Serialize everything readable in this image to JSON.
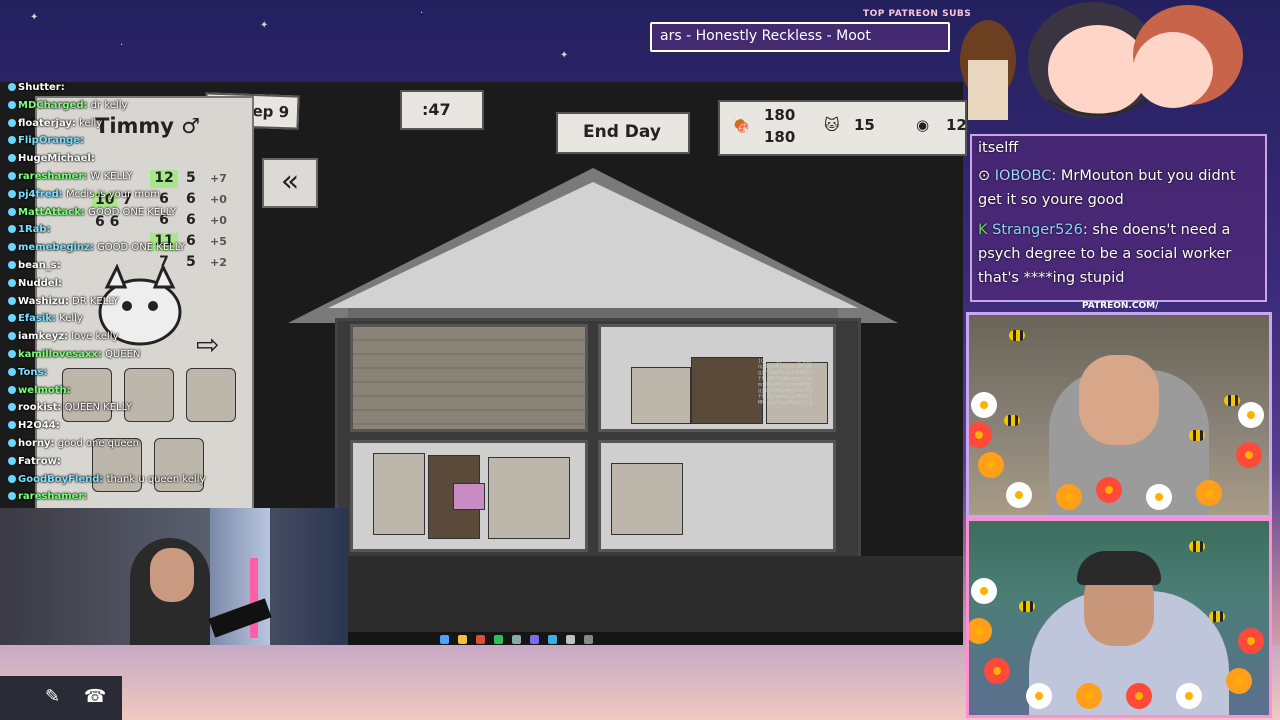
{
  "overlay": {
    "patreon_label": "TOP PATREON SUBS",
    "ticker_text": "ars - Honestly Reckless - Moot",
    "patreon_url": "PATREON.COM/"
  },
  "game": {
    "date": "Su Sep 9",
    "population": ":47",
    "end_day_label": "End Day",
    "food_current": "180",
    "food_max": "180",
    "cats_count": "15",
    "coins_count": "12",
    "cat_name": "Timmy ♂",
    "stats": [
      {
        "base": "12",
        "val": "5",
        "mod": "+7",
        "highlight": true
      },
      {
        "base": "6",
        "val": "6",
        "mod": "+0",
        "highlight": false
      },
      {
        "base": "6",
        "val": "6",
        "mod": "+0",
        "highlight": false
      },
      {
        "base": "11",
        "val": "6",
        "mod": "+5",
        "highlight": true
      },
      {
        "base": "7",
        "val": "5",
        "mod": "+2",
        "highlight": false
      }
    ],
    "left_stats": [
      {
        "a": "10",
        "b": "7"
      },
      {
        "a": "6",
        "b": "6"
      }
    ],
    "back_icon": "«",
    "next_icon": "⇨"
  },
  "chat_overlay": [
    {
      "user": "Shutter:",
      "msg": "",
      "color": "#ffffff"
    },
    {
      "user": "MDCharged:",
      "msg": "dr kelly",
      "color": "#7bff7b"
    },
    {
      "user": "floaterjay:",
      "msg": "kelly",
      "color": "#ffffff"
    },
    {
      "user": "FlipOrange:",
      "msg": "",
      "color": "#7be0ff"
    },
    {
      "user": "HugeMichael:",
      "msg": "",
      "color": "#ffffff"
    },
    {
      "user": "rareshamer:",
      "msg": "W KELLY",
      "color": "#7bff7b"
    },
    {
      "user": "pj4fred:",
      "msg": "Mcdis is your mom",
      "color": "#7be0ff"
    },
    {
      "user": "MattAttack:",
      "msg": "GOOD ONE KELLY",
      "color": "#7bff7b"
    },
    {
      "user": "1Rab:",
      "msg": "",
      "color": "#7be0ff"
    },
    {
      "user": "memebeginz:",
      "msg": "GOOD ONE KELLY",
      "color": "#7be0ff"
    },
    {
      "user": "bean_s:",
      "msg": "",
      "color": "#ffffff"
    },
    {
      "user": "Nuddel:",
      "msg": "",
      "color": "#ffffff"
    },
    {
      "user": "Washizu:",
      "msg": "DR KELLY",
      "color": "#ffffff"
    },
    {
      "user": "Efasik:",
      "msg": "Kelly",
      "color": "#7be0ff"
    },
    {
      "user": "iamkeyz:",
      "msg": "love kelly",
      "color": "#ffffff"
    },
    {
      "user": "kamillovesaxx:",
      "msg": "QUEEN",
      "color": "#7bff7b"
    },
    {
      "user": "Tons:",
      "msg": "",
      "color": "#7be0ff"
    },
    {
      "user": "welmoth:",
      "msg": "",
      "color": "#7bff7b"
    },
    {
      "user": "rookist:",
      "msg": "QUEEN KELLY",
      "color": "#ffffff"
    },
    {
      "user": "H2O44:",
      "msg": "",
      "color": "#ffffff"
    },
    {
      "user": "horny:",
      "msg": "good one queen",
      "color": "#ffffff"
    },
    {
      "user": "Fatrow:",
      "msg": "",
      "color": "#ffffff"
    },
    {
      "user": "GoodBoyFlend:",
      "msg": "thank u queen kelly",
      "color": "#7be0ff"
    },
    {
      "user": "rareshamer:",
      "msg": "",
      "color": "#7bff7b"
    }
  ],
  "chat_box": {
    "line0": "itselff",
    "user1": "IOBOBC",
    "msg1": ": MrMouton but you didnt get it so youre good",
    "user2": "Stranger526",
    "msg2": ": she doens't need a psych degree to be a social worker that's ****ing stupid"
  },
  "colors": {
    "accent_pink": "#ff8fd1",
    "accent_purple": "#c9a6f0",
    "chat_user": "#9fd7ff"
  }
}
